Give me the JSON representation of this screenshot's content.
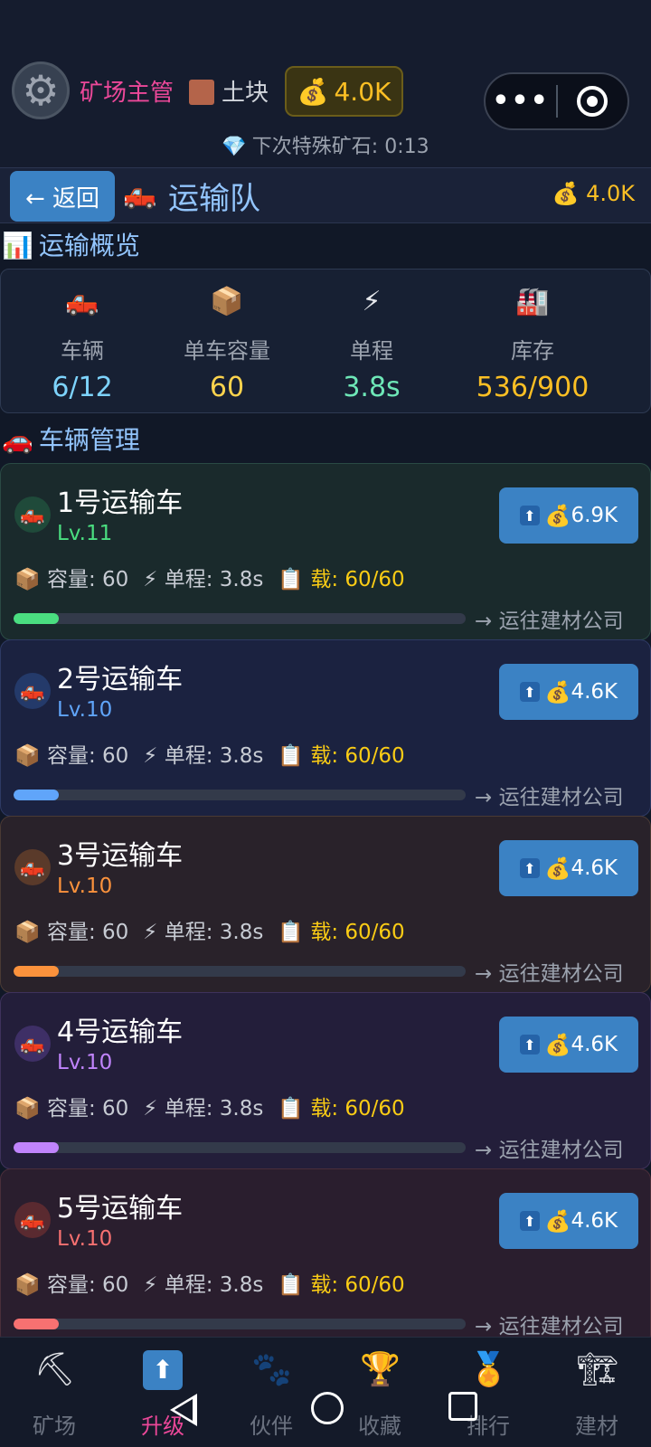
{
  "header": {
    "settings_icon": "gear-icon",
    "role": "矿场主管",
    "ore_name": "土块",
    "ore_color": "#b4644a",
    "gold": "4.0K",
    "gold_icon": "💰",
    "next_special_icon": "💎",
    "next_special": "下次特殊矿石: 0:13",
    "menu_dots": "•••"
  },
  "title_bar": {
    "back_label": "← 返回",
    "title_icon": "🛻",
    "title": "运输队",
    "gold_icon": "💰",
    "gold": "4.0K"
  },
  "overview": {
    "heading_icon": "📊",
    "heading": "运输概览",
    "items": [
      {
        "icon": "🛻",
        "label": "车辆",
        "value": "6/12",
        "color": "#7dd3fc"
      },
      {
        "icon": "📦",
        "label": "单车容量",
        "value": "60",
        "color": "#fcd34d"
      },
      {
        "icon": "⚡",
        "label": "单程",
        "value": "3.8s",
        "color": "#6ee7b7"
      },
      {
        "icon": "🏭",
        "label": "库存",
        "value": "536/900",
        "color": "#fbbf24"
      }
    ]
  },
  "vehicles": {
    "heading_icon": "🚗",
    "heading": "车辆管理",
    "items": [
      {
        "name": "1号运输车",
        "level": "Lv.11",
        "upgrade_cost": "6.9K",
        "capacity": "📦 容量: 60",
        "trip": "⚡ 单程: 3.8s",
        "load": "📋 载: 60/60",
        "destination": "→ 运往建材公司",
        "progress": 0.1,
        "color": "#4ade80",
        "bg": "#1a2a2c",
        "border": "#2a4a44",
        "avatar_bg": "#1f4a3a"
      },
      {
        "name": "2号运输车",
        "level": "Lv.10",
        "upgrade_cost": "4.6K",
        "capacity": "📦 容量: 60",
        "trip": "⚡ 单程: 3.8s",
        "load": "📋 载: 60/60",
        "destination": "→ 运往建材公司",
        "progress": 0.1,
        "color": "#60a5fa",
        "bg": "#1b2240",
        "border": "#2e3a64",
        "avatar_bg": "#243a6a"
      },
      {
        "name": "3号运输车",
        "level": "Lv.10",
        "upgrade_cost": "4.6K",
        "capacity": "📦 容量: 60",
        "trip": "⚡ 单程: 3.8s",
        "load": "📋 载: 60/60",
        "destination": "→ 运往建材公司",
        "progress": 0.1,
        "color": "#fb923c",
        "bg": "#29222a",
        "border": "#4a3a34",
        "avatar_bg": "#5a3a2a"
      },
      {
        "name": "4号运输车",
        "level": "Lv.10",
        "upgrade_cost": "4.6K",
        "capacity": "📦 容量: 60",
        "trip": "⚡ 单程: 3.8s",
        "load": "📋 载: 60/60",
        "destination": "→ 运往建材公司",
        "progress": 0.1,
        "color": "#c084fc",
        "bg": "#231e3a",
        "border": "#3e325c",
        "avatar_bg": "#3e2f66"
      },
      {
        "name": "5号运输车",
        "level": "Lv.10",
        "upgrade_cost": "4.6K",
        "capacity": "📦 容量: 60",
        "trip": "⚡ 单程: 3.8s",
        "load": "📋 载: 60/60",
        "destination": "→ 运往建材公司",
        "progress": 0.1,
        "color": "#f87171",
        "bg": "#2a1e2e",
        "border": "#4a2e3a",
        "avatar_bg": "#5a2a30"
      }
    ],
    "upgrade_arrow": "⬆",
    "upgrade_bag": "💰"
  },
  "bottom_nav": [
    {
      "icon": "⛏",
      "icon_name": "pickaxe-icon",
      "label": "矿场"
    },
    {
      "icon": "⬆",
      "icon_name": "upgrade-icon",
      "label": "升级",
      "active": true
    },
    {
      "icon": "🐾",
      "icon_name": "paw-icon",
      "label": "伙伴"
    },
    {
      "icon": "🏆",
      "icon_name": "trophy-icon",
      "label": "收藏"
    },
    {
      "icon": "🏅",
      "icon_name": "medal-icon",
      "label": "排行"
    },
    {
      "icon": "🏗",
      "icon_name": "crane-icon",
      "label": "建材"
    }
  ]
}
